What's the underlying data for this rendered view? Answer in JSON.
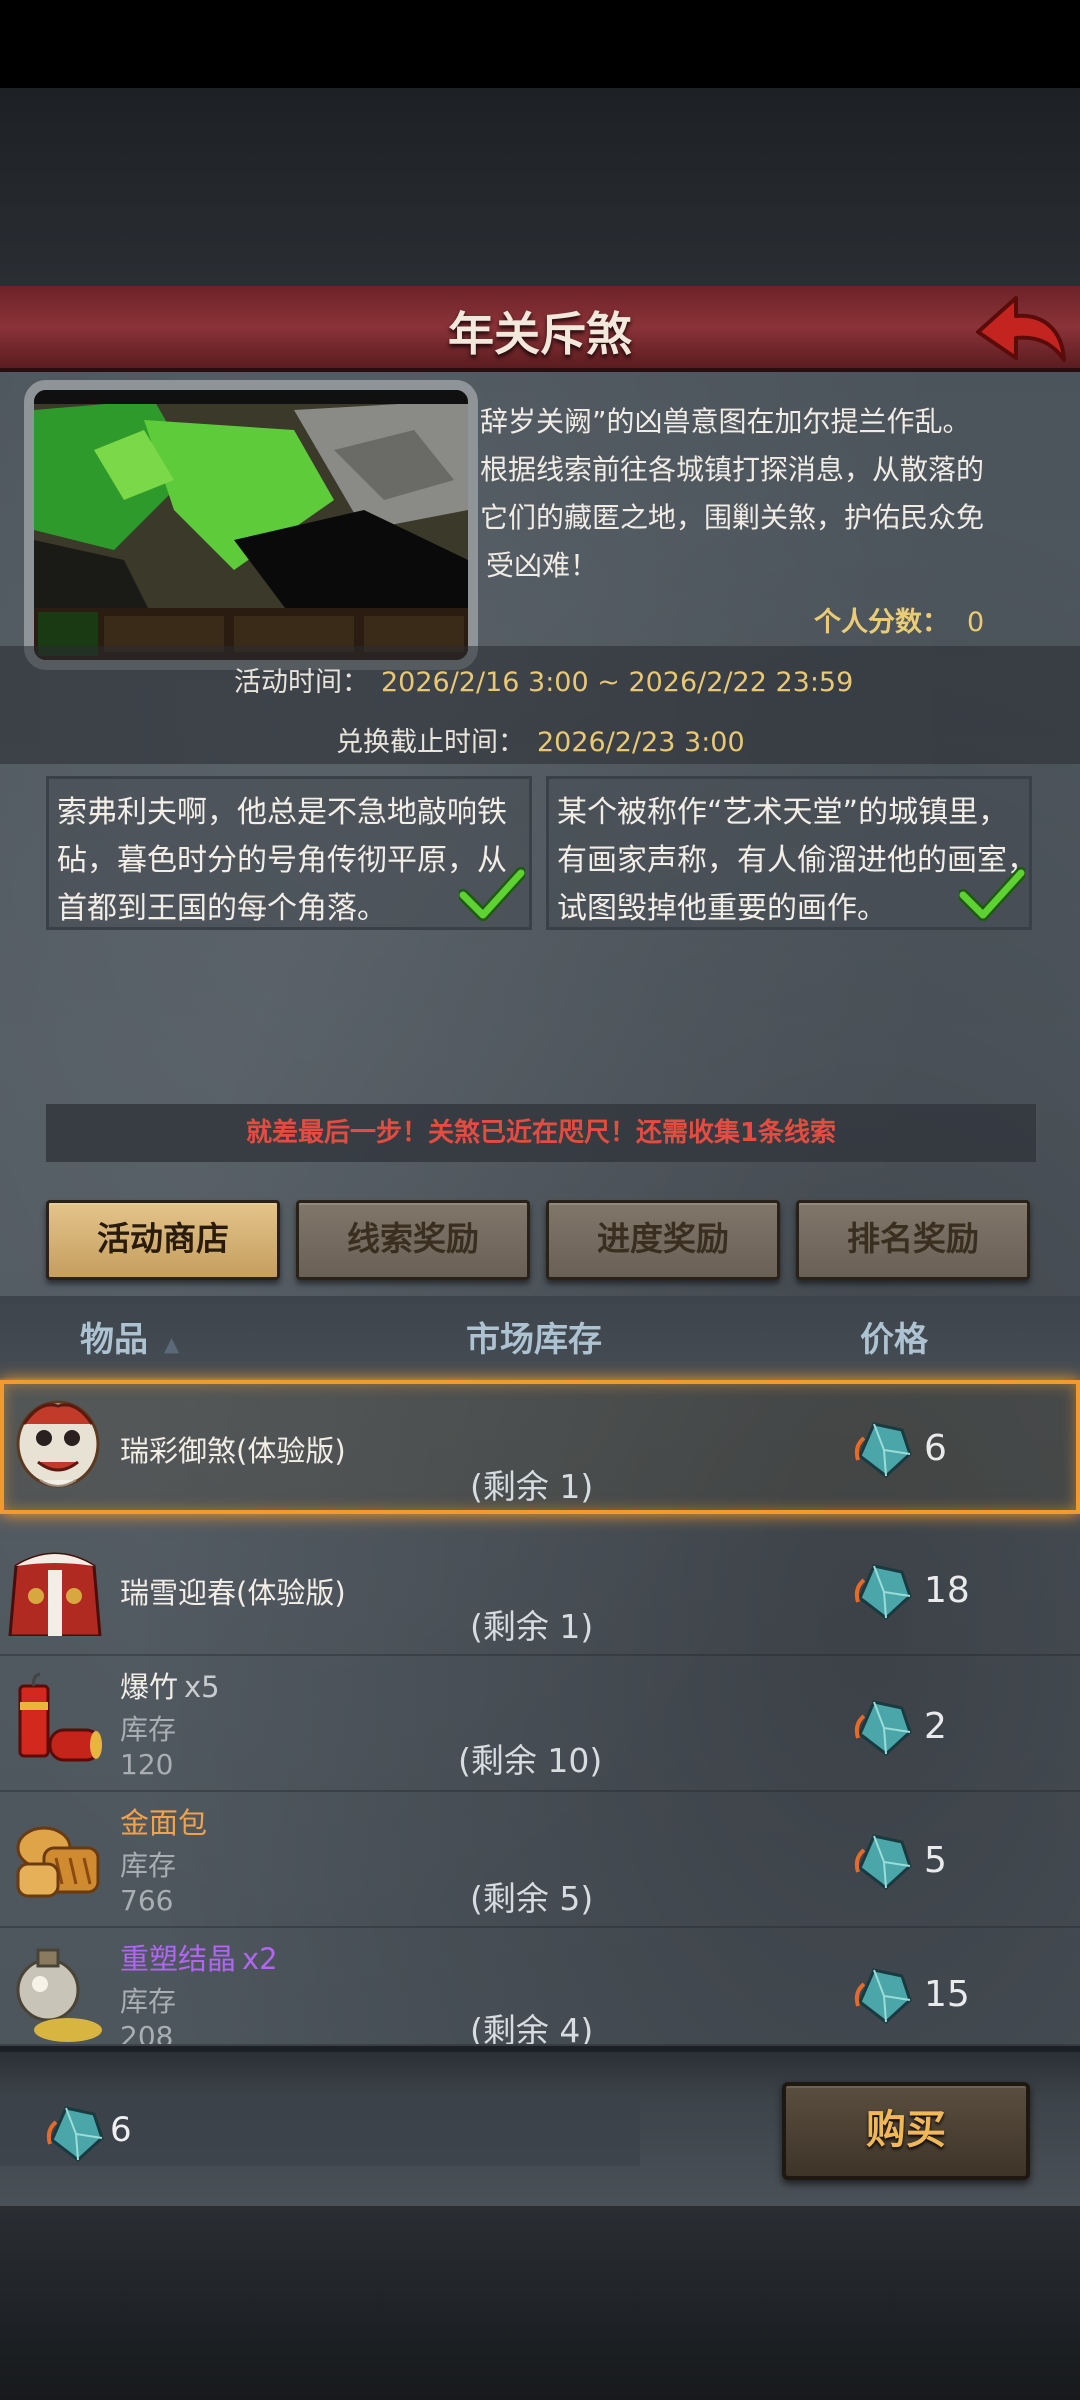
{
  "header": {
    "title": "年关斥煞"
  },
  "event": {
    "description_lines": [
      "辞岁关阙”的凶兽意图在加尔提兰作乱。",
      "根据线索前往各城镇打探消息，从散落的",
      "它们的藏匿之地，围剿关煞，护佑民众免",
      "受凶难！"
    ],
    "score_label": "个人分数：",
    "score_value": "0",
    "time_label": "活动时间：",
    "time_value": "2026/2/16 3:00 ~ 2026/2/22 23:59",
    "exchange_label": "兑换截止时间：",
    "exchange_value": "2026/2/23 3:00"
  },
  "clues": [
    {
      "lines": [
        "索弗利夫啊，他总是不急地敲响铁",
        "砧，暮色时分的号角传彻平原，从",
        "首都到王国的每个角落。"
      ],
      "completed": true
    },
    {
      "lines": [
        "某个被称作“艺术天堂”的城镇里，",
        "有画家声称，有人偷溜进他的画室，",
        "试图毁掉他重要的画作。"
      ],
      "completed": true
    }
  ],
  "hint": "就差最后一步！关煞已近在咫尺！还需收集1条线索",
  "tabs": [
    {
      "label": "活动商店",
      "active": true
    },
    {
      "label": "线索奖励",
      "active": false
    },
    {
      "label": "进度奖励",
      "active": false
    },
    {
      "label": "排名奖励",
      "active": false
    }
  ],
  "columns": {
    "item": "物品",
    "stock": "市场库存",
    "price": "价格"
  },
  "items": [
    {
      "name": "瑞彩御煞(体验版)",
      "qty": "",
      "stock_label": "",
      "stock_value": "",
      "remain": "(剩余 1)",
      "price": "6",
      "icon": "lion-dance-icon",
      "name_color": "#f2eee6",
      "selected": true
    },
    {
      "name": "瑞雪迎春(体验版)",
      "qty": "",
      "stock_label": "",
      "stock_value": "",
      "remain": "(剩余 1)",
      "price": "18",
      "icon": "winter-costume-icon",
      "name_color": "#f2eee6",
      "selected": false
    },
    {
      "name": "爆竹",
      "qty": "x5",
      "stock_label": "库存",
      "stock_value": "120",
      "remain": "(剩余 10)",
      "price": "2",
      "icon": "firecracker-icon",
      "name_color": "#f2eee6",
      "selected": false
    },
    {
      "name": "金面包",
      "qty": "",
      "stock_label": "库存",
      "stock_value": "766",
      "remain": "(剩余 5)",
      "price": "5",
      "icon": "golden-bread-icon",
      "name_color": "#f2a24a",
      "selected": false
    },
    {
      "name": "重塑结晶",
      "qty": "x2",
      "stock_label": "库存",
      "stock_value": "208",
      "remain": "(剩余 4)",
      "price": "15",
      "icon": "crystal-flask-icon",
      "name_color": "#b066f0",
      "selected": false
    }
  ],
  "footer": {
    "currency_value": "6",
    "buy_label": "购买"
  },
  "colors": {
    "accent_gold": "#e9c873",
    "hint_red": "#e44c40",
    "selected_border": "#f29a2e"
  }
}
